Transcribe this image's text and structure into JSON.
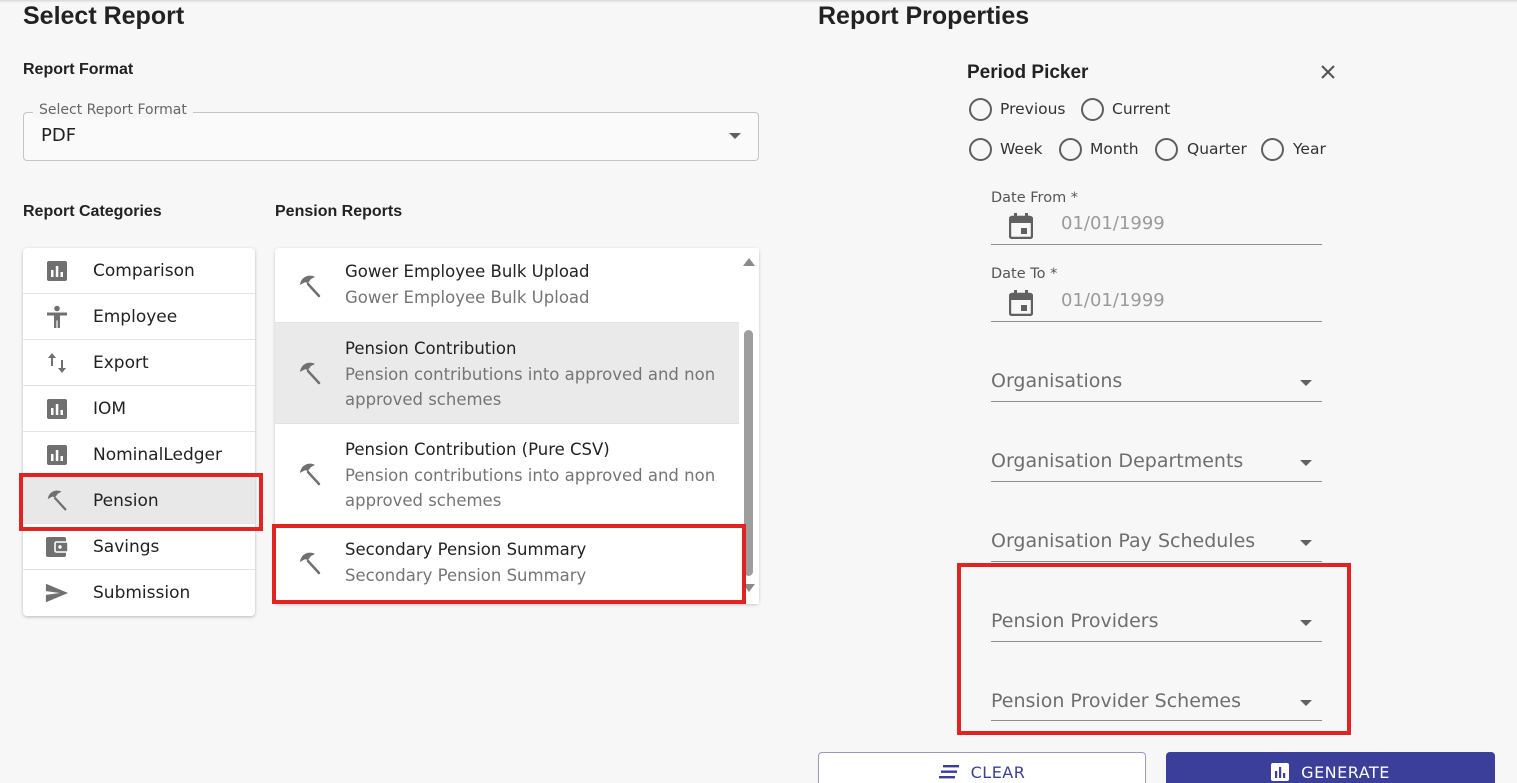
{
  "select_report": {
    "title": "Select Report",
    "format_heading": "Report Format",
    "format_select": {
      "legend": "Select Report Format",
      "value": "PDF"
    },
    "categories_heading": "Report Categories",
    "reports_heading": "Pension Reports",
    "categories": [
      {
        "label": "Comparison",
        "icon": "bar-chart-icon"
      },
      {
        "label": "Employee",
        "icon": "person-icon"
      },
      {
        "label": "Export",
        "icon": "swap-vertical-icon"
      },
      {
        "label": "IOM",
        "icon": "bar-chart-icon"
      },
      {
        "label": "NominalLedger",
        "icon": "bar-chart-icon"
      },
      {
        "label": "Pension",
        "icon": "umbrella-icon",
        "selected": true
      },
      {
        "label": "Savings",
        "icon": "wallet-icon"
      },
      {
        "label": "Submission",
        "icon": "send-icon"
      }
    ],
    "reports": [
      {
        "title": "Gower Employee Bulk Upload",
        "subtitle": "Gower Employee Bulk Upload",
        "icon": "umbrella-icon"
      },
      {
        "title": "Pension Contribution",
        "subtitle": "Pension contributions into approved and non approved schemes",
        "icon": "umbrella-icon",
        "selected": true
      },
      {
        "title": "Pension Contribution (Pure CSV)",
        "subtitle": "Pension contributions into approved and non approved schemes",
        "icon": "umbrella-icon"
      },
      {
        "title": "Secondary Pension Summary",
        "subtitle": "Secondary Pension Summary",
        "icon": "umbrella-icon"
      }
    ]
  },
  "report_properties": {
    "title": "Report Properties",
    "period_picker": {
      "title": "Period Picker",
      "options_row1": [
        "Previous",
        "Current"
      ],
      "options_row2": [
        "Week",
        "Month",
        "Quarter",
        "Year"
      ]
    },
    "date_from": {
      "label": "Date From *",
      "value": "01/01/1999"
    },
    "date_to": {
      "label": "Date To *",
      "value": "01/01/1999"
    },
    "dropdowns": [
      "Organisations",
      "Organisation Departments",
      "Organisation Pay Schedules",
      "Pension Providers",
      "Pension Provider Schemes"
    ]
  },
  "actions": {
    "clear_label": "CLEAR",
    "generate_label": "GENERATE"
  },
  "colors": {
    "primary": "#3b3f9a",
    "highlight": "#e02424",
    "icon_gray": "#707070"
  }
}
